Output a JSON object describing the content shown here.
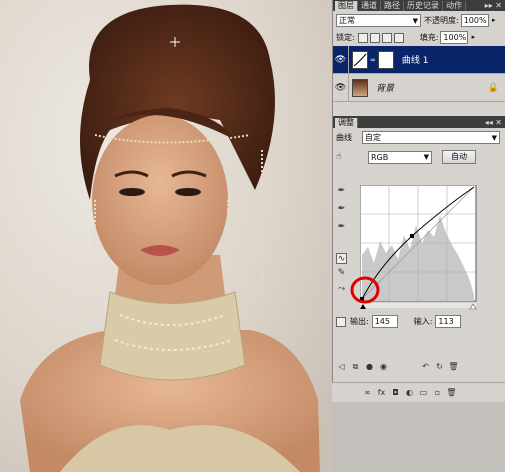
{
  "layers_panel": {
    "tabs": [
      "图层",
      "通道",
      "路径",
      "历史记录",
      "动作"
    ],
    "tab_controls": "▸▸ ✕",
    "blend_mode": "正常",
    "opacity_label": "不透明度:",
    "opacity_value": "100%",
    "lock_label": "锁定:",
    "fill_label": "填充:",
    "fill_value": "100%",
    "layers": [
      {
        "name": "曲线 1",
        "visible": true,
        "selected": true
      },
      {
        "name": "背景",
        "visible": true,
        "selected": false,
        "locked": true
      }
    ]
  },
  "adjust_panel": {
    "title": "调整",
    "title_controls": "◂◂ ✕",
    "curves_label": "曲线",
    "preset": "自定",
    "channel": "RGB",
    "auto_label": "自动",
    "output_label": "输出:",
    "output_value": "145",
    "input_label": "输入:",
    "input_value": "113"
  },
  "colors": {
    "selection": "#0a246a",
    "panel_bg": "#d6d3ce",
    "annotation_circle": "#e00000"
  }
}
